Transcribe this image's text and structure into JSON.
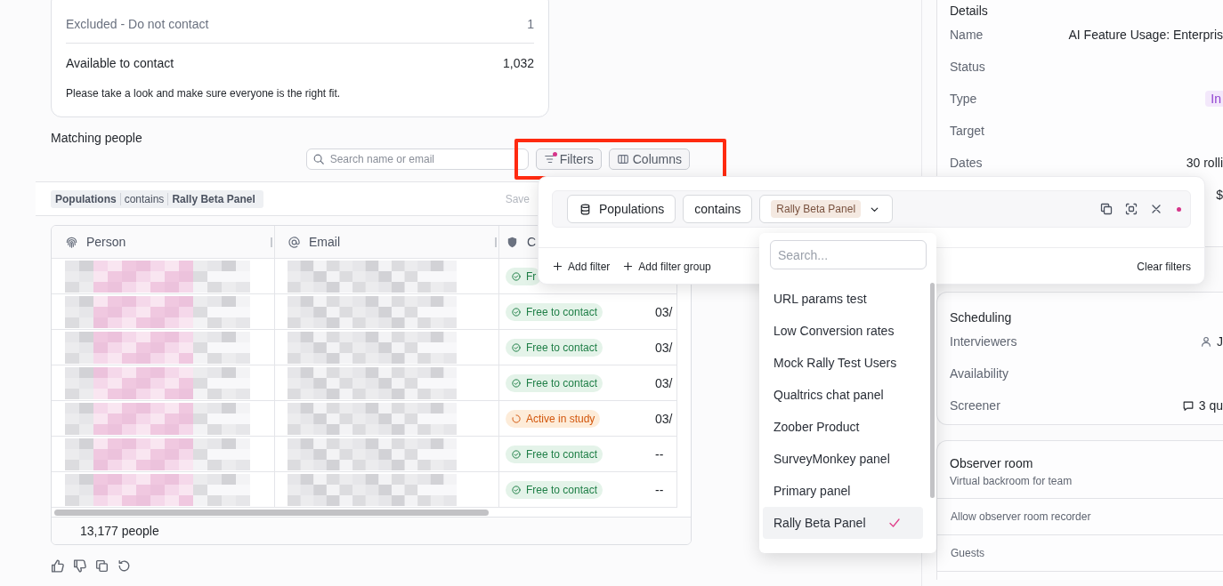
{
  "summary": {
    "rows": [
      {
        "label": "Excluded - Do not contact",
        "value": "1",
        "kind": "muted"
      },
      {
        "label": "Available to contact",
        "value": "1,032",
        "kind": "strong"
      }
    ],
    "note": "Please take a look and make sure everyone is the right fit."
  },
  "matching_people": {
    "title": "Matching people",
    "highlighted": true,
    "search": {
      "placeholder": "Search name or email"
    },
    "filters_button": {
      "label": "Filters",
      "active": true
    },
    "columns_button": {
      "label": "Columns"
    },
    "applied_filter": {
      "field": "Populations",
      "operator": "contains",
      "value": "Rally Beta Panel"
    },
    "save": {
      "label": "Save",
      "disabled": true
    }
  },
  "table": {
    "columns": [
      {
        "label": "Person",
        "kind": "person"
      },
      {
        "label": "Email",
        "kind": "email"
      },
      {
        "label": "C",
        "kind": "consent"
      }
    ],
    "rows": [
      {
        "status": {
          "label": "Fr",
          "kind": "free"
        }
      },
      {
        "status": {
          "label": "Free to contact",
          "kind": "free"
        },
        "date": "03/"
      },
      {
        "status": {
          "label": "Free to contact",
          "kind": "free"
        },
        "date": "03/"
      },
      {
        "status": {
          "label": "Free to contact",
          "kind": "free"
        },
        "date": "03/"
      },
      {
        "status": {
          "label": "Active in study",
          "kind": "active"
        },
        "date": "03/"
      },
      {
        "status": {
          "label": "Free to contact",
          "kind": "free"
        },
        "date": "--"
      },
      {
        "status": {
          "label": "Free to contact",
          "kind": "free"
        },
        "date": "--"
      }
    ],
    "footer": "13,177 people"
  },
  "filter_popover": {
    "field": "Populations",
    "operator": "contains",
    "value": "Rally Beta Panel",
    "has_changes": true,
    "add_filter": "Add filter",
    "add_group": "Add filter group",
    "clear": "Clear filters"
  },
  "dropdown": {
    "placeholder": "Search...",
    "options": [
      {
        "label": "URL params test",
        "selected": false
      },
      {
        "label": "Low Conversion rates",
        "selected": false
      },
      {
        "label": "Mock Rally Test Users",
        "selected": false
      },
      {
        "label": "Qualtrics chat panel",
        "selected": false
      },
      {
        "label": "Zoober Product",
        "selected": false
      },
      {
        "label": "SurveyMonkey panel",
        "selected": false
      },
      {
        "label": "Primary panel",
        "selected": false
      },
      {
        "label": "Rally Beta Panel",
        "selected": true
      }
    ]
  },
  "details": {
    "title": "Details",
    "rows": [
      {
        "label": "Name",
        "value": "AI Feature Usage: Enterpris"
      },
      {
        "label": "Status"
      },
      {
        "label": "Type",
        "value": "In",
        "kind": "badge"
      },
      {
        "label": "Target"
      },
      {
        "label": "Dates",
        "value": "30 rolli"
      },
      {
        "value": "$"
      }
    ]
  },
  "scheduling": {
    "title": "Scheduling",
    "rows": [
      {
        "label": "Interviewers",
        "value": "J",
        "kind": "person"
      },
      {
        "label": "Availability"
      },
      {
        "label": "Screener",
        "value": "3 qu",
        "kind": "questions"
      }
    ]
  },
  "observer_room": {
    "title": "Observer room",
    "subtitle": "Virtual backroom for team",
    "rows": [
      "Allow observer room recorder",
      "Guests"
    ]
  }
}
